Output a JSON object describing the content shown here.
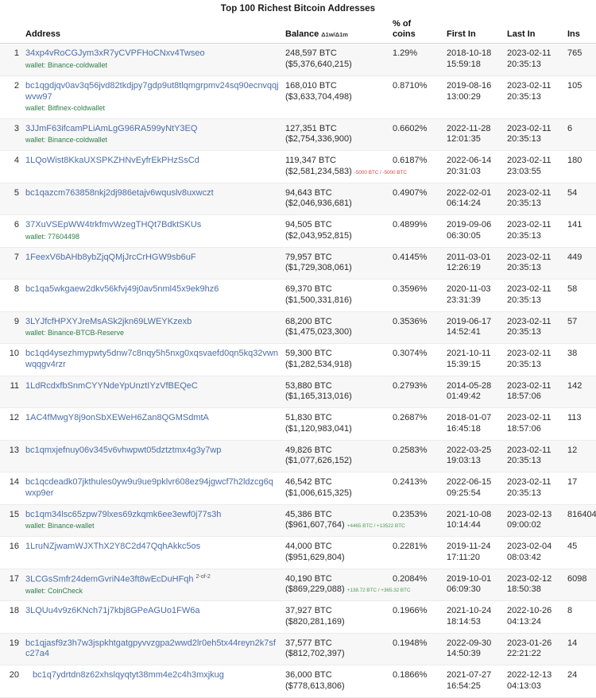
{
  "page": {
    "title": "Top 100 Richest Bitcoin Addresses"
  },
  "table": {
    "headers": {
      "rank": "",
      "address": "Address",
      "balance": "Balance",
      "balance_delta": "Δ1w/Δ1m",
      "pct_line1": "% of",
      "pct_line2": "coins",
      "first_in": "First In",
      "last_in": "Last In",
      "ins": "Ins"
    },
    "rows": [
      {
        "rank": "1",
        "address": "34xp4vRoCGJym3xR7yCVPFHoCNxv4Twseo",
        "wallet": "wallet: Binance-coldwallet",
        "balance": "248,597 BTC ($5,376,640,215)",
        "balance_line1": "248,597 BTC ($5,376,640,215)",
        "balance_line2": "",
        "delta": "",
        "delta_sign": "",
        "pct": "1.29%",
        "first_in_date": "2018-10-18",
        "first_in_time": "15:59:18",
        "last_in_date": "2023-02-11",
        "last_in_time": "20:35:13",
        "ins": "765",
        "indent": false,
        "multisig": ""
      },
      {
        "rank": "2",
        "address": "bc1qgdjqv0av3q56jvd82tkdjpy7gdp9ut8tlqmgrpmv24sq90ecnvqqjwvw97",
        "wallet": "wallet: Bitfinex-coldwallet",
        "balance": "168,010 BTC ($3,633,704,498)",
        "balance_line1": "168,010 BTC ($3,633,704,498)",
        "balance_line2": "",
        "delta": "",
        "delta_sign": "",
        "pct": "0.8710%",
        "first_in_date": "2019-08-16",
        "first_in_time": "13:00:29",
        "last_in_date": "2023-02-11",
        "last_in_time": "20:35:13",
        "ins": "105",
        "indent": false,
        "multisig": ""
      },
      {
        "rank": "3",
        "address": "3JJmF63ifcamPLiAmLgG96RA599yNtY3EQ",
        "wallet": "wallet: Binance-coldwallet",
        "balance": "127,351 BTC ($2,754,336,900)",
        "balance_line1": "127,351 BTC ($2,754,336,900)",
        "balance_line2": "",
        "delta": "",
        "delta_sign": "",
        "pct": "0.6602%",
        "first_in_date": "2022-11-28",
        "first_in_time": "12:01:35",
        "last_in_date": "2023-02-11",
        "last_in_time": "20:35:13",
        "ins": "6",
        "indent": false,
        "multisig": ""
      },
      {
        "rank": "4",
        "address": "1LQoWist8KkaUXSPKZHNvEyfrEkPHzSsCd",
        "wallet": "",
        "balance": "119,347 BTC ($2,581,234,583)",
        "balance_line1": "119,347 BTC",
        "balance_line2": "($2,581,234,583)",
        "delta": "-5000 BTC / -5000 BTC",
        "delta_sign": "neg",
        "pct": "0.6187%",
        "first_in_date": "2022-06-14",
        "first_in_time": "20:31:03",
        "last_in_date": "2023-02-11",
        "last_in_time": "23:03:55",
        "ins": "180",
        "indent": false,
        "multisig": ""
      },
      {
        "rank": "5",
        "address": "bc1qazcm763858nkj2dj986etajv6wquslv8uxwczt",
        "wallet": "",
        "balance": "94,643 BTC ($2,046,936,681)",
        "balance_line1": "94,643 BTC ($2,046,936,681)",
        "balance_line2": "",
        "delta": "",
        "delta_sign": "",
        "pct": "0.4907%",
        "first_in_date": "2022-02-01",
        "first_in_time": "06:14:24",
        "last_in_date": "2023-02-11",
        "last_in_time": "20:35:13",
        "ins": "54",
        "indent": false,
        "multisig": ""
      },
      {
        "rank": "6",
        "address": "37XuVSEpWW4trkfmvWzegTHQt7BdktSKUs",
        "wallet": "wallet: 77604498",
        "balance": "94,505 BTC ($2,043,952,815)",
        "balance_line1": "94,505 BTC ($2,043,952,815)",
        "balance_line2": "",
        "delta": "",
        "delta_sign": "",
        "pct": "0.4899%",
        "first_in_date": "2019-09-06",
        "first_in_time": "06:30:05",
        "last_in_date": "2023-02-11",
        "last_in_time": "20:35:13",
        "ins": "141",
        "indent": false,
        "multisig": ""
      },
      {
        "rank": "7",
        "address": "1FeexV6bAHb8ybZjqQMjJrcCrHGW9sb6uF",
        "wallet": "",
        "balance": "79,957 BTC ($1,729,308,061)",
        "balance_line1": "79,957 BTC ($1,729,308,061)",
        "balance_line2": "",
        "delta": "",
        "delta_sign": "",
        "pct": "0.4145%",
        "first_in_date": "2011-03-01",
        "first_in_time": "12:26:19",
        "last_in_date": "2023-02-11",
        "last_in_time": "20:35:13",
        "ins": "449",
        "indent": false,
        "multisig": ""
      },
      {
        "rank": "8",
        "address": "bc1qa5wkgaew2dkv56kfvj49j0av5nml45x9ek9hz6",
        "wallet": "",
        "balance": "69,370 BTC ($1,500,331,816)",
        "balance_line1": "69,370 BTC ($1,500,331,816)",
        "balance_line2": "",
        "delta": "",
        "delta_sign": "",
        "pct": "0.3596%",
        "first_in_date": "2020-11-03",
        "first_in_time": "23:31:39",
        "last_in_date": "2023-02-11",
        "last_in_time": "20:35:13",
        "ins": "58",
        "indent": false,
        "multisig": ""
      },
      {
        "rank": "9",
        "address": "3LYJfcfHPXYJreMsASk2jkn69LWEYKzexb",
        "wallet": "wallet: Binance-BTCB-Reserve",
        "balance": "68,200 BTC ($1,475,023,300)",
        "balance_line1": "68,200 BTC ($1,475,023,300)",
        "balance_line2": "",
        "delta": "",
        "delta_sign": "",
        "pct": "0.3536%",
        "first_in_date": "2019-06-17",
        "first_in_time": "14:52:41",
        "last_in_date": "2023-02-11",
        "last_in_time": "20:35:13",
        "ins": "57",
        "indent": false,
        "multisig": ""
      },
      {
        "rank": "10",
        "address": "bc1qd4ysezhmypwty5dnw7c8nqy5h5nxg0xqsvaefd0qn5kq32vwnwqqgv4rzr",
        "wallet": "",
        "balance": "59,300 BTC ($1,282,534,918)",
        "balance_line1": "59,300 BTC ($1,282,534,918)",
        "balance_line2": "",
        "delta": "",
        "delta_sign": "",
        "pct": "0.3074%",
        "first_in_date": "2021-10-11",
        "first_in_time": "15:39:15",
        "last_in_date": "2023-02-11",
        "last_in_time": "20:35:13",
        "ins": "38",
        "indent": false,
        "multisig": ""
      },
      {
        "rank": "11",
        "address": "1LdRcdxfbSnmCYYNdeYpUnztIYzVfBEQeC",
        "wallet": "",
        "balance": "53,880 BTC ($1,165,313,016)",
        "balance_line1": "53,880 BTC ($1,165,313,016)",
        "balance_line2": "",
        "delta": "",
        "delta_sign": "",
        "pct": "0.2793%",
        "first_in_date": "2014-05-28",
        "first_in_time": "01:49:42",
        "last_in_date": "2023-02-11",
        "last_in_time": "18:57:06",
        "ins": "142",
        "indent": false,
        "multisig": ""
      },
      {
        "rank": "12",
        "address": "1AC4fMwgY8j9onSbXEWeH6Zan8QGMSdmtA",
        "wallet": "",
        "balance": "51,830 BTC ($1,120,983,041)",
        "balance_line1": "51,830 BTC ($1,120,983,041)",
        "balance_line2": "",
        "delta": "",
        "delta_sign": "",
        "pct": "0.2687%",
        "first_in_date": "2018-01-07",
        "first_in_time": "16:45:18",
        "last_in_date": "2023-02-11",
        "last_in_time": "18:57:06",
        "ins": "113",
        "indent": false,
        "multisig": ""
      },
      {
        "rank": "13",
        "address": "bc1qmxjefnuy06v345v6vhwpwt05dztztmx4g3y7wp",
        "wallet": "",
        "balance": "49,826 BTC ($1,077,626,152)",
        "balance_line1": "49,826 BTC ($1,077,626,152)",
        "balance_line2": "",
        "delta": "",
        "delta_sign": "",
        "pct": "0.2583%",
        "first_in_date": "2022-03-25",
        "first_in_time": "19:03:13",
        "last_in_date": "2023-02-11",
        "last_in_time": "20:35:13",
        "ins": "12",
        "indent": false,
        "multisig": ""
      },
      {
        "rank": "14",
        "address": "bc1qcdeadk07jkthules0yw9u9ue9pklvr608ez94jgwcf7h2ldzcg6qwxp9er",
        "wallet": "",
        "balance": "46,542 BTC ($1,006,615,325)",
        "balance_line1": "46,542 BTC ($1,006,615,325)",
        "balance_line2": "",
        "delta": "",
        "delta_sign": "",
        "pct": "0.2413%",
        "first_in_date": "2022-06-15",
        "first_in_time": "09:25:54",
        "last_in_date": "2023-02-11",
        "last_in_time": "20:35:13",
        "ins": "17",
        "indent": false,
        "multisig": ""
      },
      {
        "rank": "15",
        "address": "bc1qm34lsc65zpw79lxes69zkqmk6ee3ewf0j77s3h",
        "wallet": "wallet: Binance-wallet",
        "balance": "45,386 BTC ($961,607,764)",
        "balance_line1": "45,386 BTC",
        "balance_line2": "($961,607,764)",
        "delta": "+4465 BTC / +13522 BTC",
        "delta_sign": "pos",
        "pct": "0.2353%",
        "first_in_date": "2021-10-08",
        "first_in_time": "10:14:44",
        "last_in_date": "2023-02-13",
        "last_in_time": "09:00:02",
        "ins": "816404",
        "indent": false,
        "multisig": ""
      },
      {
        "rank": "16",
        "address": "1LruNZjwamWJXThX2Y8C2d47QqhAkkc5os",
        "wallet": "",
        "balance": "44,000 BTC ($951,629,804)",
        "balance_line1": "44,000 BTC ($951,629,804)",
        "balance_line2": "",
        "delta": "",
        "delta_sign": "",
        "pct": "0.2281%",
        "first_in_date": "2019-11-24",
        "first_in_time": "17:11:20",
        "last_in_date": "2023-02-04",
        "last_in_time": "08:03:42",
        "ins": "45",
        "indent": false,
        "multisig": ""
      },
      {
        "rank": "17",
        "address": "3LCGsSmfr24demGvriN4e3ft8wEcDuHFqh",
        "wallet": "wallet: CoinCheck",
        "balance": "40,190 BTC ($869,229,088)",
        "balance_line1": "40,190 BTC",
        "balance_line2": "($869,229,088)",
        "delta": "+138.72 BTC / +365.32 BTC",
        "delta_sign": "pos",
        "pct": "0.2084%",
        "first_in_date": "2019-10-01",
        "first_in_time": "06:09:30",
        "last_in_date": "2023-02-12",
        "last_in_time": "18:50:38",
        "ins": "6098",
        "indent": false,
        "multisig": "2-of-2"
      },
      {
        "rank": "18",
        "address": "3LQUu4v9z6KNch71j7kbj8GPeAGUo1FW6a",
        "wallet": "",
        "balance": "37,927 BTC ($820,281,169)",
        "balance_line1": "37,927 BTC ($820,281,169)",
        "balance_line2": "",
        "delta": "",
        "delta_sign": "",
        "pct": "0.1966%",
        "first_in_date": "2021-10-24",
        "first_in_time": "18:14:53",
        "last_in_date": "2022-10-26",
        "last_in_time": "04:13:24",
        "ins": "8",
        "indent": false,
        "multisig": ""
      },
      {
        "rank": "19",
        "address": "bc1qjasf9z3h7w3jspkhtgatgpyvvzgpa2wwd2lr0eh5tx44reyn2k7sfc27a4",
        "wallet": "",
        "balance": "37,577 BTC ($812,702,397)",
        "balance_line1": "37,577 BTC ($812,702,397)",
        "balance_line2": "",
        "delta": "",
        "delta_sign": "",
        "pct": "0.1948%",
        "first_in_date": "2022-09-30",
        "first_in_time": "14:50:39",
        "last_in_date": "2023-01-26",
        "last_in_time": "22:21:22",
        "ins": "14",
        "indent": false,
        "multisig": ""
      },
      {
        "rank": "20",
        "address": "bc1q7ydrtdn8z62xhslqyqtyt38mm4e2c4h3mxjkug",
        "wallet": "",
        "balance": "36,000 BTC ($778,613,806)",
        "balance_line1": "36,000 BTC ($778,613,806)",
        "balance_line2": "",
        "delta": "",
        "delta_sign": "",
        "pct": "0.1866%",
        "first_in_date": "2021-07-27",
        "first_in_time": "16:54:25",
        "last_in_date": "2022-12-13",
        "last_in_time": "04:13:03",
        "ins": "24",
        "indent": true,
        "multisig": ""
      }
    ]
  },
  "colors": {
    "link": "#4b6ea8",
    "wallet": "#2e7d49",
    "delta_positive": "#4f9c54",
    "delta_negative": "#d14b4b",
    "row_stripe": "#f7f7f7"
  }
}
